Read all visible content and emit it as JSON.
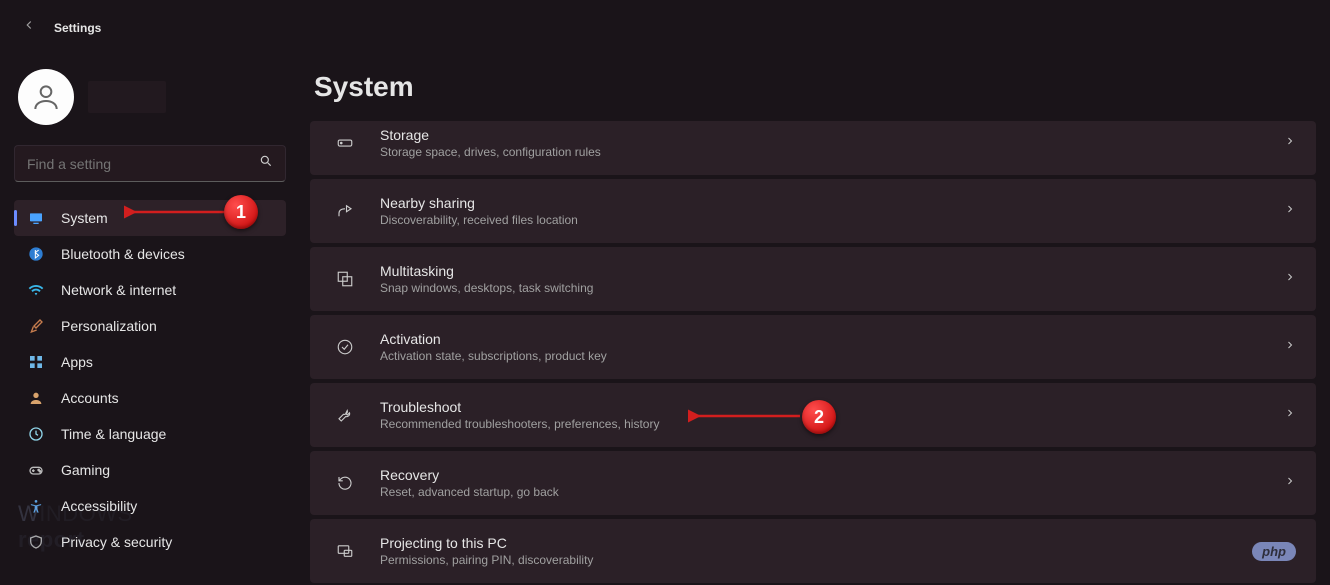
{
  "header": {
    "title": "Settings"
  },
  "user": {
    "name_hidden": true
  },
  "search": {
    "placeholder": "Find a setting"
  },
  "sidebar": {
    "items": [
      {
        "label": "System",
        "icon": "system",
        "selected": true
      },
      {
        "label": "Bluetooth & devices",
        "icon": "bluetooth"
      },
      {
        "label": "Network & internet",
        "icon": "wifi"
      },
      {
        "label": "Personalization",
        "icon": "brush"
      },
      {
        "label": "Apps",
        "icon": "apps"
      },
      {
        "label": "Accounts",
        "icon": "person"
      },
      {
        "label": "Time & language",
        "icon": "clock"
      },
      {
        "label": "Gaming",
        "icon": "gamepad"
      },
      {
        "label": "Accessibility",
        "icon": "accessibility"
      },
      {
        "label": "Privacy & security",
        "icon": "shield"
      }
    ]
  },
  "page": {
    "title": "System"
  },
  "settings": [
    {
      "title": "Storage",
      "desc": "Storage space, drives, configuration rules",
      "icon": "storage"
    },
    {
      "title": "Nearby sharing",
      "desc": "Discoverability, received files location",
      "icon": "share"
    },
    {
      "title": "Multitasking",
      "desc": "Snap windows, desktops, task switching",
      "icon": "multitask"
    },
    {
      "title": "Activation",
      "desc": "Activation state, subscriptions, product key",
      "icon": "check"
    },
    {
      "title": "Troubleshoot",
      "desc": "Recommended troubleshooters, preferences, history",
      "icon": "wrench"
    },
    {
      "title": "Recovery",
      "desc": "Reset, advanced startup, go back",
      "icon": "recovery"
    },
    {
      "title": "Projecting to this PC",
      "desc": "Permissions, pairing PIN, discoverability",
      "icon": "project"
    }
  ],
  "annotations": {
    "marker1": "1",
    "marker2": "2"
  },
  "badges": {
    "php": "php"
  }
}
